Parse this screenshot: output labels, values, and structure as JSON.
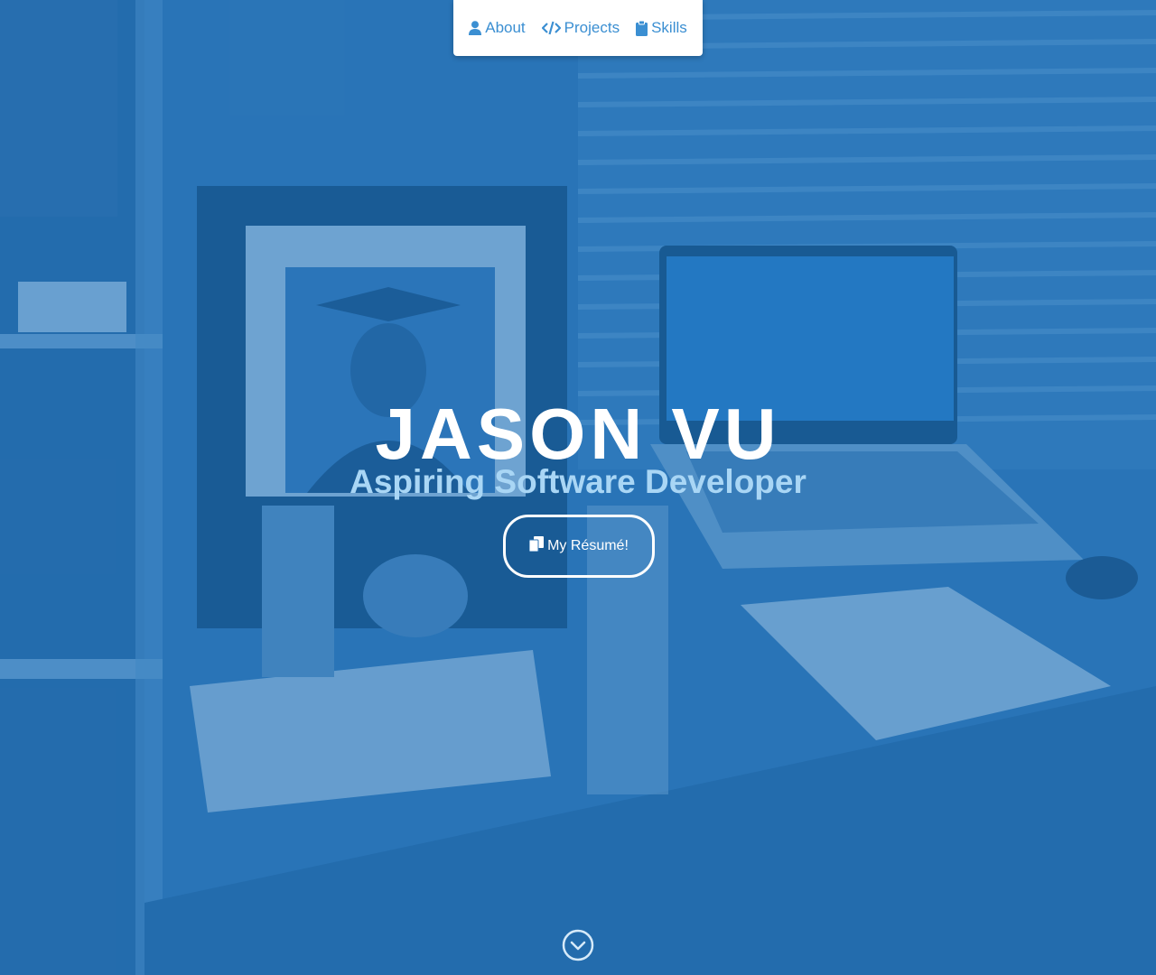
{
  "nav": {
    "items": [
      {
        "label": "About",
        "icon": "user-icon"
      },
      {
        "label": "Projects",
        "icon": "code-icon"
      },
      {
        "label": "Skills",
        "icon": "clipboard-icon"
      }
    ]
  },
  "hero": {
    "title": "JASON VU",
    "subtitle": "Aspiring Software Developer",
    "resume_label": "My Résumé!",
    "resume_icon": "copy-icon",
    "scroll_icon": "chevron-circle-down-icon"
  },
  "colors": {
    "accent": "#3b8fd2",
    "overlay": "#1c6eb4",
    "subtitle": "#a9d6f5"
  }
}
